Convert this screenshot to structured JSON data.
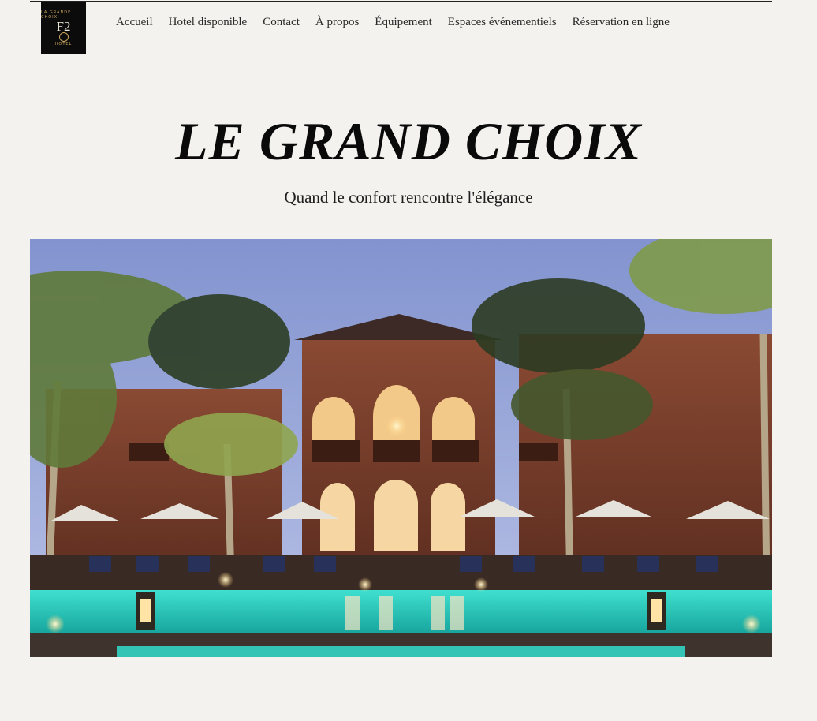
{
  "logo": {
    "arc_text": "LA GRANDE CHOIX",
    "mark": "F2",
    "sub_text": "HOTEL"
  },
  "nav": {
    "items": [
      {
        "label": "Accueil"
      },
      {
        "label": "Hotel disponible"
      },
      {
        "label": "Contact"
      },
      {
        "label": "À propos"
      },
      {
        "label": "Équipement"
      },
      {
        "label": "Espaces événementiels"
      },
      {
        "label": "Réservation en ligne"
      }
    ]
  },
  "hero": {
    "title": "LE GRAND CHOIX",
    "subtitle": "Quand le confort rencontre l'élégance"
  },
  "colors": {
    "background": "#f3f2ee",
    "logo_bg": "#0b0b0b",
    "logo_gold": "#c9a45c",
    "sky": "#8d9fd6",
    "building": "#7a3f2c",
    "pool": "#2fd1c4"
  }
}
